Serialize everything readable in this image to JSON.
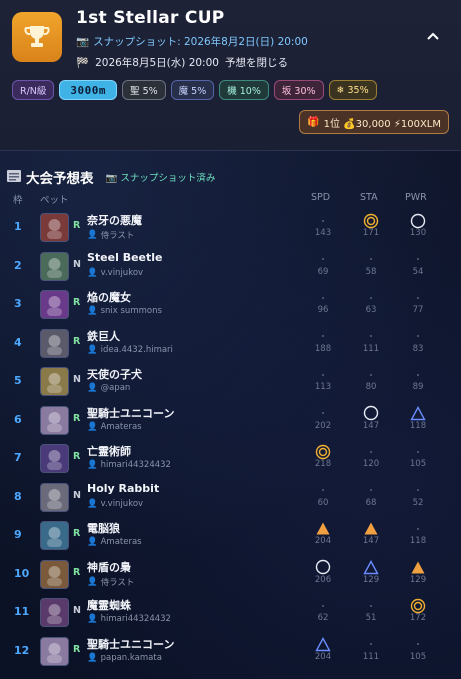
{
  "header": {
    "title": "1st Stellar CUP",
    "snapshot": "スナップショット: 2026年8月2日(日) 20:00",
    "race_date": "2026年8月5日(水) 20:00",
    "close_label": "予想を閉じる"
  },
  "badges": {
    "rank": "R/N級",
    "distance": "3000m",
    "sei": "聖 5%",
    "ma": "魔 5%",
    "ki": "機 10%",
    "saka": "坂 30%",
    "snow": "❄ 35%"
  },
  "prize": "1位 💰30,000 ⚡100XLM",
  "table": {
    "title": "大会予想表",
    "status": "スナップショット済み",
    "col_frame": "枠",
    "col_pet": "ペット",
    "col_spd": "SPD",
    "col_sta": "STA",
    "col_pwr": "PWR",
    "rows": [
      {
        "no": "1",
        "rarity": "R",
        "name": "奈牙の悪魔",
        "owner": "侍ラスト",
        "spd": {
          "mark": "dot",
          "val": "143"
        },
        "sta": {
          "mark": "double",
          "val": "171"
        },
        "pwr": {
          "mark": "circle",
          "val": "130"
        }
      },
      {
        "no": "2",
        "rarity": "N",
        "name": "Steel Beetle",
        "owner": "v.vinjukov",
        "spd": {
          "mark": "dot",
          "val": "69"
        },
        "sta": {
          "mark": "dot",
          "val": "58"
        },
        "pwr": {
          "mark": "dot",
          "val": "54"
        }
      },
      {
        "no": "3",
        "rarity": "R",
        "name": "焔の魔女",
        "owner": "snix summons",
        "spd": {
          "mark": "dot",
          "val": "96"
        },
        "sta": {
          "mark": "dot",
          "val": "63"
        },
        "pwr": {
          "mark": "dot",
          "val": "77"
        }
      },
      {
        "no": "4",
        "rarity": "R",
        "name": "鉄巨人",
        "owner": "idea.4432.himari",
        "spd": {
          "mark": "dot",
          "val": "188"
        },
        "sta": {
          "mark": "dot",
          "val": "111"
        },
        "pwr": {
          "mark": "dot",
          "val": "83"
        }
      },
      {
        "no": "5",
        "rarity": "N",
        "name": "天使の子犬",
        "owner": "@apan",
        "spd": {
          "mark": "dot",
          "val": "113"
        },
        "sta": {
          "mark": "dot",
          "val": "80"
        },
        "pwr": {
          "mark": "dot",
          "val": "89"
        }
      },
      {
        "no": "6",
        "rarity": "R",
        "name": "聖騎士ユニコーン",
        "owner": "Amateras",
        "spd": {
          "mark": "dot",
          "val": "202"
        },
        "sta": {
          "mark": "circle",
          "val": "147"
        },
        "pwr": {
          "mark": "tri-blue",
          "val": "118"
        }
      },
      {
        "no": "7",
        "rarity": "R",
        "name": "亡霊術師",
        "owner": "himari44324432",
        "spd": {
          "mark": "double",
          "val": "218"
        },
        "sta": {
          "mark": "dot",
          "val": "120"
        },
        "pwr": {
          "mark": "dot",
          "val": "105"
        }
      },
      {
        "no": "8",
        "rarity": "N",
        "name": "Holy Rabbit",
        "owner": "v.vinjukov",
        "spd": {
          "mark": "dot",
          "val": "60"
        },
        "sta": {
          "mark": "dot",
          "val": "68"
        },
        "pwr": {
          "mark": "dot",
          "val": "52"
        }
      },
      {
        "no": "9",
        "rarity": "R",
        "name": "電脳狼",
        "owner": "Amateras",
        "spd": {
          "mark": "tri-orange",
          "val": "204"
        },
        "sta": {
          "mark": "tri-orange",
          "val": "147"
        },
        "pwr": {
          "mark": "dot",
          "val": "118"
        }
      },
      {
        "no": "10",
        "rarity": "R",
        "name": "神盾の梟",
        "owner": "侍ラスト",
        "spd": {
          "mark": "circle",
          "val": "206"
        },
        "sta": {
          "mark": "tri-blue",
          "val": "129"
        },
        "pwr": {
          "mark": "tri-orange",
          "val": "129"
        }
      },
      {
        "no": "11",
        "rarity": "N",
        "name": "魔霊蜘蛛",
        "owner": "himari44324432",
        "spd": {
          "mark": "dot",
          "val": "62"
        },
        "sta": {
          "mark": "dot",
          "val": "51"
        },
        "pwr": {
          "mark": "double",
          "val": "172"
        }
      },
      {
        "no": "12",
        "rarity": "R",
        "name": "聖騎士ユニコーン",
        "owner": "papan.kamata",
        "spd": {
          "mark": "tri-blue",
          "val": "204"
        },
        "sta": {
          "mark": "dot",
          "val": "111"
        },
        "pwr": {
          "mark": "dot",
          "val": "105"
        }
      }
    ]
  },
  "colors": {
    "accent": "#4da8ff",
    "gold": "#f0a52b",
    "orange": "#f0a040",
    "blue": "#6a8cff"
  }
}
